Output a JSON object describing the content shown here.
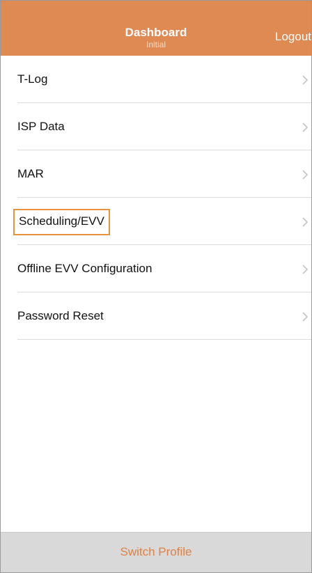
{
  "nav": {
    "title": "Dashboard",
    "subtitle": "Initial",
    "logout_label": "Logout"
  },
  "menu": {
    "items": [
      {
        "label": "T-Log",
        "icon": "chevron-right-icon"
      },
      {
        "label": "ISP Data",
        "icon": "chevron-right-icon"
      },
      {
        "label": "MAR",
        "icon": "chevron-right-icon"
      },
      {
        "label": "Scheduling/EVV",
        "icon": "chevron-right-icon",
        "highlighted": true
      },
      {
        "label": "Offline EVV Configuration",
        "icon": "chevron-right-icon"
      },
      {
        "label": "Password Reset",
        "icon": "chevron-right-icon"
      }
    ]
  },
  "footer": {
    "switch_profile_label": "Switch Profile"
  },
  "colors": {
    "nav_background": "#de8a52",
    "highlight_border": "#e8923d",
    "footer_background": "#d9d9d9",
    "footer_text": "#dc8246"
  }
}
